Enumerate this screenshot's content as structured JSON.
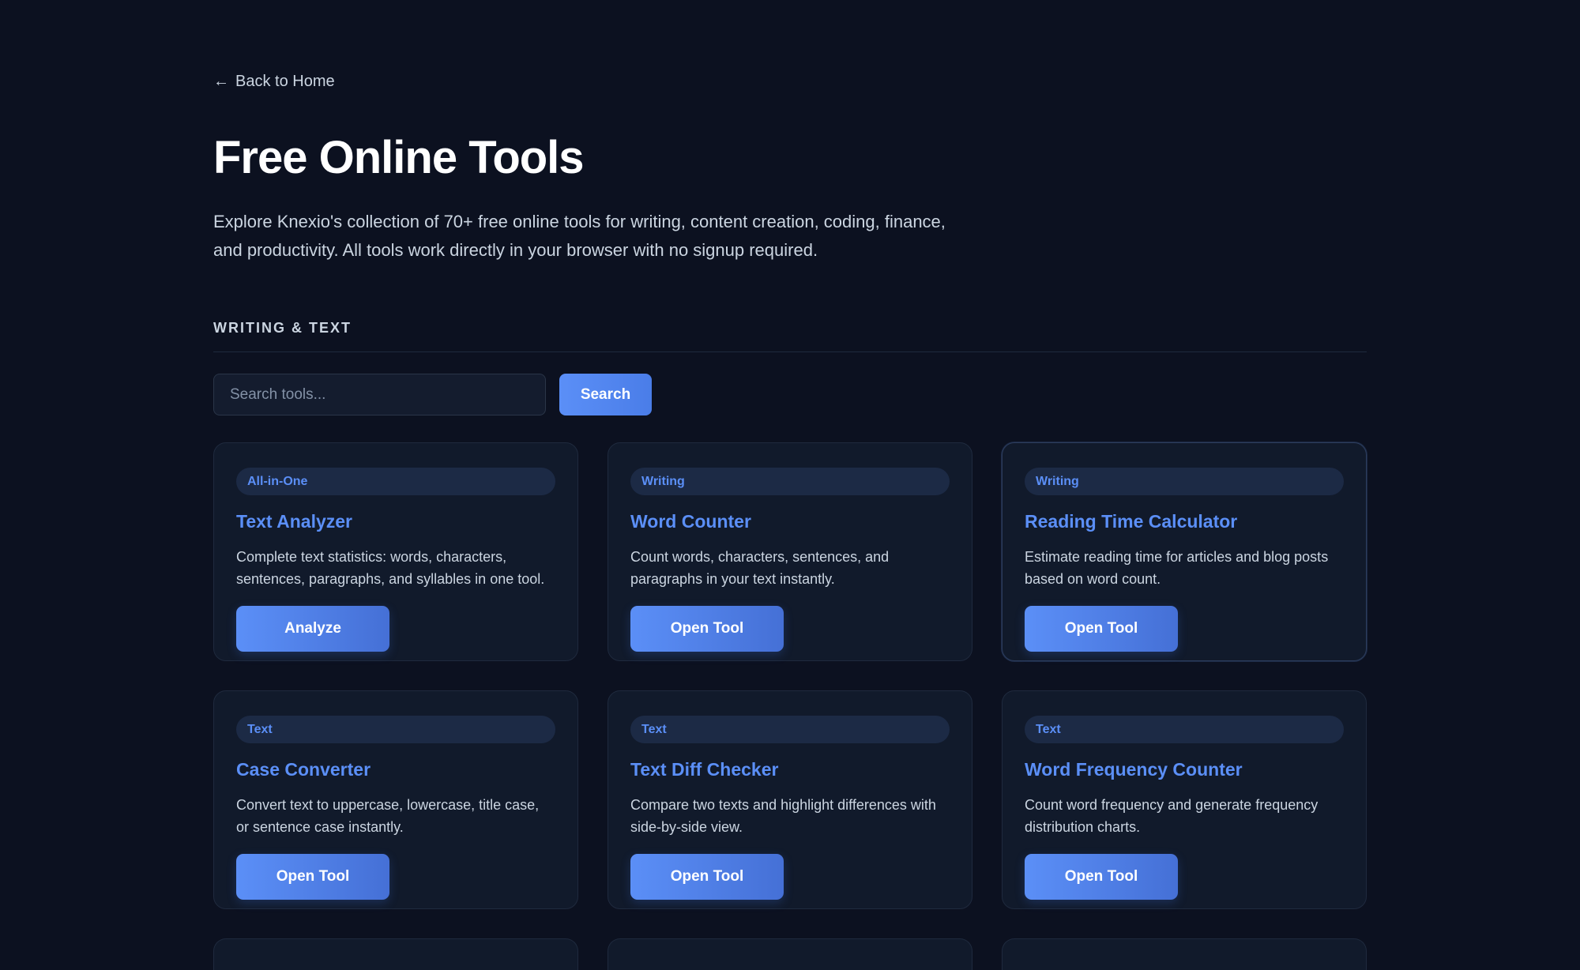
{
  "nav": {
    "back_label": "Back to Home",
    "back_icon": "arrow-left-icon"
  },
  "header": {
    "title": "Free Online Tools",
    "subtitle": "Explore Knexio's collection of 70+ free online tools for writing, content creation, coding, finance, and productivity. All tools work directly in your browser with no signup required."
  },
  "section": {
    "heading": "WRITING & TEXT"
  },
  "search": {
    "placeholder": "Search tools...",
    "value": "",
    "button_label": "Search"
  },
  "tools": [
    {
      "badge": "All-in-One",
      "title": "Text Analyzer",
      "description": "Complete text statistics: words, characters, sentences, paragraphs, and syllables in one tool.",
      "button": "Analyze"
    },
    {
      "badge": "Writing",
      "title": "Word Counter",
      "description": "Count words, characters, sentences, and paragraphs in your text instantly.",
      "button": "Open Tool"
    },
    {
      "badge": "Writing",
      "title": "Reading Time Calculator",
      "description": "Estimate reading time for articles and blog posts based on word count.",
      "button": "Open Tool"
    },
    {
      "badge": "Text",
      "title": "Case Converter",
      "description": "Convert text to uppercase, lowercase, title case, or sentence case instantly.",
      "button": "Open Tool"
    },
    {
      "badge": "Text",
      "title": "Text Diff Checker",
      "description": "Compare two texts and highlight differences with side-by-side view.",
      "button": "Open Tool"
    },
    {
      "badge": "Text",
      "title": "Word Frequency Counter",
      "description": "Count word frequency and generate frequency distribution charts.",
      "button": "Open Tool"
    }
  ],
  "colors": {
    "background": "#0c1120",
    "accent": "#5b8ff7",
    "card": "#111a2b"
  }
}
